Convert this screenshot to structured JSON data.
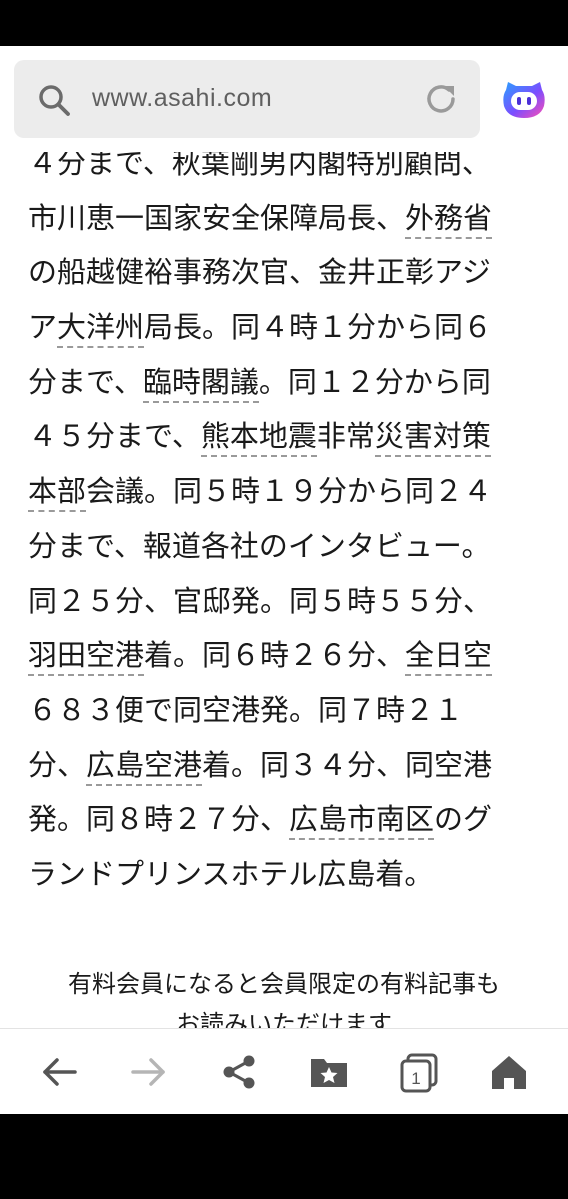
{
  "browser": {
    "url": "www.asahi.com",
    "accent_color": "#7b4dff",
    "icons": {
      "search": "search-icon",
      "reload": "reload-icon",
      "assistant": "assistant-face-icon"
    }
  },
  "article": {
    "lines": [
      [
        {
          "t": "４分まで、秋葉剛男内閣特別顧問、"
        }
      ],
      [
        {
          "t": "市川恵一国家安全保障局長、"
        },
        {
          "t": "外務省",
          "kw": true
        }
      ],
      [
        {
          "t": "の船越健裕事務次官、金井正彰アジ"
        }
      ],
      [
        {
          "t": "ア"
        },
        {
          "t": "大洋州",
          "kw": true
        },
        {
          "t": "局長。同４時１分から同６"
        }
      ],
      [
        {
          "t": "分まで、"
        },
        {
          "t": "臨時閣議",
          "kw": true
        },
        {
          "t": "。同１２分から同"
        }
      ],
      [
        {
          "t": "４５分まで、"
        },
        {
          "t": "熊本地震",
          "kw": true
        },
        {
          "t": "非常"
        },
        {
          "t": "災害対策",
          "kw": true
        }
      ],
      [
        {
          "t": "本部",
          "kw": true
        },
        {
          "t": "会議。同５時１９分から同２４"
        }
      ],
      [
        {
          "t": "分まで、報道各社のインタビュー。"
        }
      ],
      [
        {
          "t": "同２５分、官邸発。同５時５５分、"
        }
      ],
      [
        {
          "t": "羽田空港",
          "kw": true
        },
        {
          "t": "着。同６時２６分、"
        },
        {
          "t": "全日空",
          "kw": true
        }
      ],
      [
        {
          "t": "６８３便で同空港発。同７時２１"
        }
      ],
      [
        {
          "t": "分、"
        },
        {
          "t": "広島空港",
          "kw": true
        },
        {
          "t": "着。同３４分、同空港"
        }
      ],
      [
        {
          "t": "発。同８時２７分、"
        },
        {
          "t": "広島市南区",
          "kw": true
        },
        {
          "t": "のグ"
        }
      ],
      [
        {
          "t": "ランドプリンスホテル広島着。"
        }
      ]
    ]
  },
  "promo": {
    "line1": "有料会員になると会員限定の有料記事も",
    "line2": "お読みいただけます"
  },
  "bottom_nav": {
    "tab_count": "1",
    "icons": [
      "back-arrow-icon",
      "forward-arrow-icon",
      "share-icon",
      "bookmark-folder-icon",
      "tabs-icon",
      "home-icon"
    ]
  }
}
